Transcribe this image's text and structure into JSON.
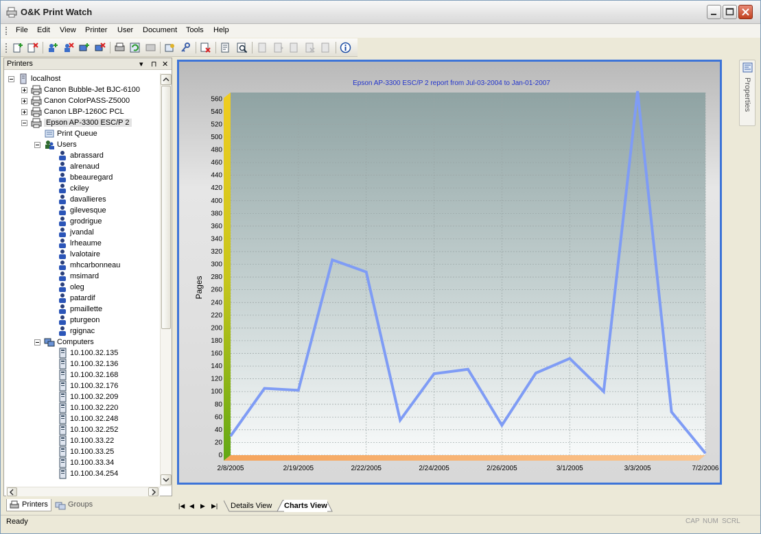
{
  "window": {
    "title": "O&K Print Watch"
  },
  "menu": [
    "File",
    "Edit",
    "View",
    "Printer",
    "User",
    "Document",
    "Tools",
    "Help"
  ],
  "panel": {
    "title": "Printers",
    "pin": "▾",
    "close": "✕",
    "dock": "⊓"
  },
  "tree": {
    "root": "localhost",
    "printers": [
      "Canon Bubble-Jet BJC-6100",
      "Canon ColorPASS-Z5000",
      "Canon LBP-1260C PCL",
      "Epson AP-3300 ESC/P 2"
    ],
    "print_queue": "Print Queue",
    "users_label": "Users",
    "users": [
      "abrassard",
      "alrenaud",
      "bbeauregard",
      "ckiley",
      "davallieres",
      "gilevesque",
      "grodrigue",
      "jvandal",
      "lrheaume",
      "lvalotaire",
      "mhcarbonneau",
      "msimard",
      "oleg",
      "patardif",
      "pmaillette",
      "pturgeon",
      "rgignac"
    ],
    "computers_label": "Computers",
    "computers": [
      "10.100.32.135",
      "10.100.32.136",
      "10.100.32.168",
      "10.100.32.176",
      "10.100.32.209",
      "10.100.32.220",
      "10.100.32.248",
      "10.100.32.252",
      "10.100.33.22",
      "10.100.33.25",
      "10.100.33.34",
      "10.100.34.254"
    ]
  },
  "bottom_tabs": {
    "printers": "Printers",
    "groups": "Groups"
  },
  "view_tabs": {
    "details": "Details View",
    "charts": "Charts View"
  },
  "right_panel": {
    "label": "Properties"
  },
  "status": {
    "text": "Ready",
    "cap": "CAP",
    "num": "NUM",
    "scrl": "SCRL"
  },
  "colors": {
    "series": "#7f9cf5",
    "accent_frame": "#3d74d8",
    "title_text": "#2233cc"
  },
  "chart_data": {
    "type": "line",
    "title": "Epson AP-3300 ESC/P 2 report from Jul-03-2004 to Jan-01-2007",
    "ylabel": "Pages",
    "xlabel": "",
    "ylim": [
      0,
      570
    ],
    "yticks": [
      0,
      20,
      40,
      60,
      80,
      100,
      120,
      140,
      160,
      180,
      200,
      220,
      240,
      260,
      280,
      300,
      320,
      340,
      360,
      380,
      400,
      420,
      440,
      460,
      480,
      500,
      520,
      540,
      560
    ],
    "x": [
      "2/8/2005",
      "",
      "2/19/2005",
      "",
      "2/22/2005",
      "",
      "2/24/2005",
      "",
      "2/26/2005",
      "",
      "3/1/2005",
      "",
      "3/3/2005",
      "",
      "7/2/2006"
    ],
    "xtick_labels": [
      "2/8/2005",
      "2/19/2005",
      "2/22/2005",
      "2/24/2005",
      "2/26/2005",
      "3/1/2005",
      "3/3/2005",
      "7/2/2006"
    ],
    "series": [
      {
        "name": "",
        "values": [
          30,
          105,
          102,
          307,
          288,
          55,
          128,
          135,
          47,
          129,
          152,
          100,
          572,
          68,
          3
        ]
      }
    ],
    "grid": true,
    "legend": "none"
  }
}
